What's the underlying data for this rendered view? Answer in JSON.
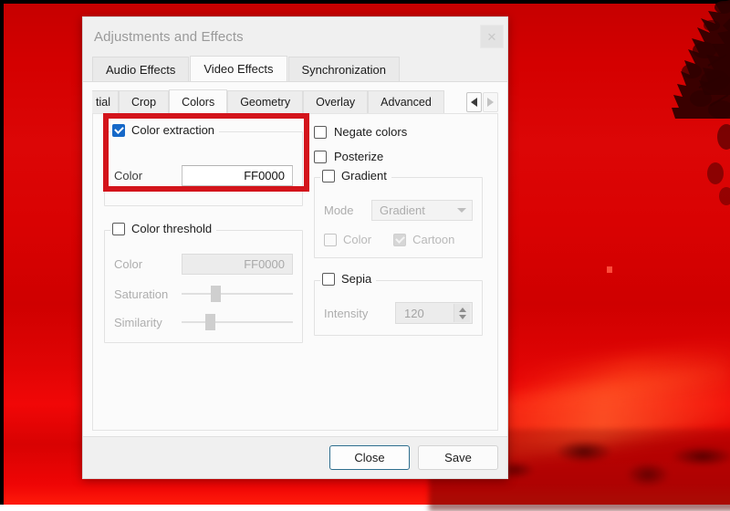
{
  "background": {
    "description": "red-filtered video frame with dark tree silhouette",
    "base_color": "#d40000",
    "streak_color": "#ff4b1e",
    "silhouette_color": "#3a0000"
  },
  "dialog": {
    "title": "Adjustments and Effects",
    "close_icon": "✕"
  },
  "main_tabs": [
    {
      "label": "Audio Effects",
      "active": false
    },
    {
      "label": "Video Effects",
      "active": true
    },
    {
      "label": "Synchronization",
      "active": false
    }
  ],
  "sub_tabs": [
    {
      "label": "tial",
      "active": false,
      "clipped": true
    },
    {
      "label": "Crop",
      "active": false
    },
    {
      "label": "Colors",
      "active": true
    },
    {
      "label": "Geometry",
      "active": false
    },
    {
      "label": "Overlay",
      "active": false
    },
    {
      "label": "Advanced",
      "active": false
    }
  ],
  "sub_tab_nav": {
    "prev_icon": "◀",
    "next_icon": "▶",
    "prev_enabled": true,
    "next_enabled": false
  },
  "left_column": {
    "color_extraction": {
      "title": "Color extraction",
      "checked": true,
      "enabled": true,
      "color_label": "Color",
      "color_value": "FF0000"
    },
    "color_threshold": {
      "title": "Color threshold",
      "checked": false,
      "enabled": false,
      "color_label": "Color",
      "color_value": "FF0000",
      "saturation_label": "Saturation",
      "saturation_percent": 30,
      "similarity_label": "Similarity",
      "similarity_percent": 25
    }
  },
  "right_column": {
    "negate_colors": {
      "label": "Negate colors",
      "checked": false
    },
    "posterize": {
      "label": "Posterize",
      "checked": false
    },
    "gradient": {
      "title": "Gradient",
      "checked": false,
      "mode_label": "Mode",
      "mode_value": "Gradient",
      "color_label": "Color",
      "color_checked": false,
      "cartoon_label": "Cartoon",
      "cartoon_checked": true
    },
    "sepia": {
      "title": "Sepia",
      "checked": false,
      "intensity_label": "Intensity",
      "intensity_value": "120"
    }
  },
  "footer": {
    "close_label": "Close",
    "save_label": "Save"
  },
  "annotation": {
    "color": "#d3141b",
    "target": "color-extraction-group"
  }
}
